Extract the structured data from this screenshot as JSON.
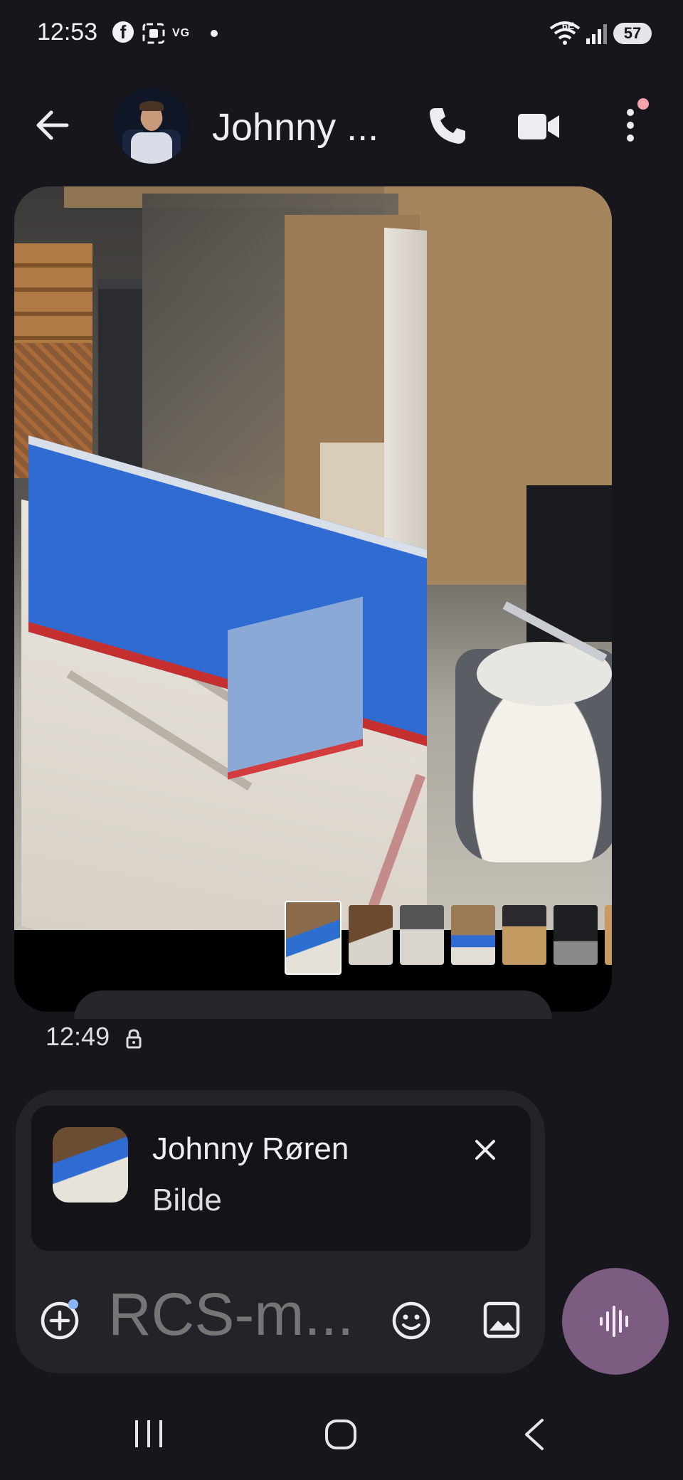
{
  "status_bar": {
    "time": "12:53",
    "icons": [
      "facebook-icon",
      "screenshot-icon",
      "vg-app-icon",
      "notification-dot-icon"
    ],
    "network": "6E",
    "battery": "57"
  },
  "header": {
    "contact_name": "Johnny ...",
    "actions": [
      "phone-icon",
      "video-call-icon",
      "more-vert-icon"
    ]
  },
  "message": {
    "type": "image",
    "thumbnail_count": 7,
    "time": "12:49"
  },
  "reply_preview": {
    "sender": "Johnny Røren",
    "type_label": "Bilde"
  },
  "composer": {
    "placeholder": "RCS-m..."
  },
  "colors": {
    "background": "#16161c",
    "bubble": "#000000",
    "composer": "#23232a",
    "voice_button": "#7c5c80",
    "badge": "#f4a3ad"
  }
}
